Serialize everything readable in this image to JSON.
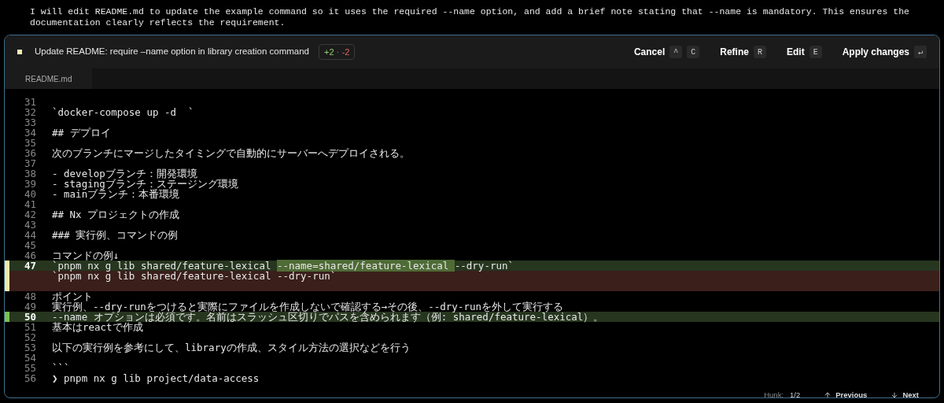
{
  "message": "I will edit README.md to update the example command so it uses the required --name option, and add a brief note stating that --name is mandatory. This ensures the documentation clearly reflects the requirement.",
  "header": {
    "title": "Update README: require –name option in library creation command",
    "additions": "+2",
    "separator": "•",
    "deletions": "-2",
    "actions": [
      {
        "label": "Cancel",
        "keys": [
          "^",
          "C"
        ]
      },
      {
        "label": "Refine",
        "keys": [
          "R"
        ]
      },
      {
        "label": "Edit",
        "keys": [
          "E"
        ]
      },
      {
        "label": "Apply changes",
        "keys": [
          "↵"
        ]
      }
    ]
  },
  "tabs": [
    {
      "label": "README.md",
      "selected": true
    }
  ],
  "lines": [
    {
      "num": "31",
      "kind": "context"
    },
    {
      "num": "32",
      "kind": "context",
      "text": "`docker-compose up -d  `"
    },
    {
      "num": "33",
      "kind": "context"
    },
    {
      "num": "34",
      "kind": "context",
      "text": "## デプロイ"
    },
    {
      "num": "35",
      "kind": "context"
    },
    {
      "num": "36",
      "kind": "context",
      "text": "次のブランチにマージしたタイミングで自動的にサーバーへデプロイされる。"
    },
    {
      "num": "37",
      "kind": "context"
    },
    {
      "num": "38",
      "kind": "context",
      "text": "- developブランチ：開発環境"
    },
    {
      "num": "39",
      "kind": "context",
      "text": "- stagingブランチ：ステージング環境"
    },
    {
      "num": "40",
      "kind": "context",
      "text": "- mainブランチ：本番環境"
    },
    {
      "num": "41",
      "kind": "context"
    },
    {
      "num": "42",
      "kind": "context",
      "text": "## Nx プロジェクトの作成"
    },
    {
      "num": "43",
      "kind": "context"
    },
    {
      "num": "44",
      "kind": "context",
      "text": "### 実行例、コマンドの例"
    },
    {
      "num": "45",
      "kind": "context"
    },
    {
      "num": "46",
      "kind": "context",
      "text": "コマンドの例↓"
    },
    {
      "num": "47",
      "kind": "added",
      "current": true,
      "segments": [
        {
          "text": "`pnpm nx g lib shared/feature-lexical ",
          "highlight": false
        },
        {
          "text": "--name=shared/feature-lexical ",
          "highlight": true
        },
        {
          "text": "--dry-run`",
          "highlight": false
        }
      ]
    },
    {
      "kind": "removed",
      "current": true,
      "text": "`pnpm nx g lib shared/feature-lexical --dry-run`"
    },
    {
      "kind": "removed",
      "current": true
    },
    {
      "num": "48",
      "kind": "context",
      "text": "ポイント"
    },
    {
      "num": "49",
      "kind": "context",
      "text": "実行例、--dry-runをつけると実際にファイルを作成しないで確認する→その後、--dry-runを外して実行する"
    },
    {
      "num": "50",
      "kind": "added",
      "current": false,
      "text": "--name オプションは必須です。名前はスラッシュ区切りでパスを含められます（例: shared/feature-lexical）。"
    },
    {
      "num": "51",
      "kind": "context",
      "text": "基本はreactで作成"
    },
    {
      "num": "52",
      "kind": "context"
    },
    {
      "num": "53",
      "kind": "context",
      "text": "以下の実行例を参考にして、libraryの作成、スタイル方法の選択などを行う"
    },
    {
      "num": "54",
      "kind": "context"
    },
    {
      "num": "55",
      "kind": "context",
      "text": "```"
    },
    {
      "num": "56",
      "kind": "context",
      "text": "❯ pnpm nx g lib project/data-access"
    }
  ],
  "footer": {
    "hunk_label": "Hunk:",
    "hunk_value": "1/2",
    "previous": "Previous",
    "next": "Next"
  }
}
